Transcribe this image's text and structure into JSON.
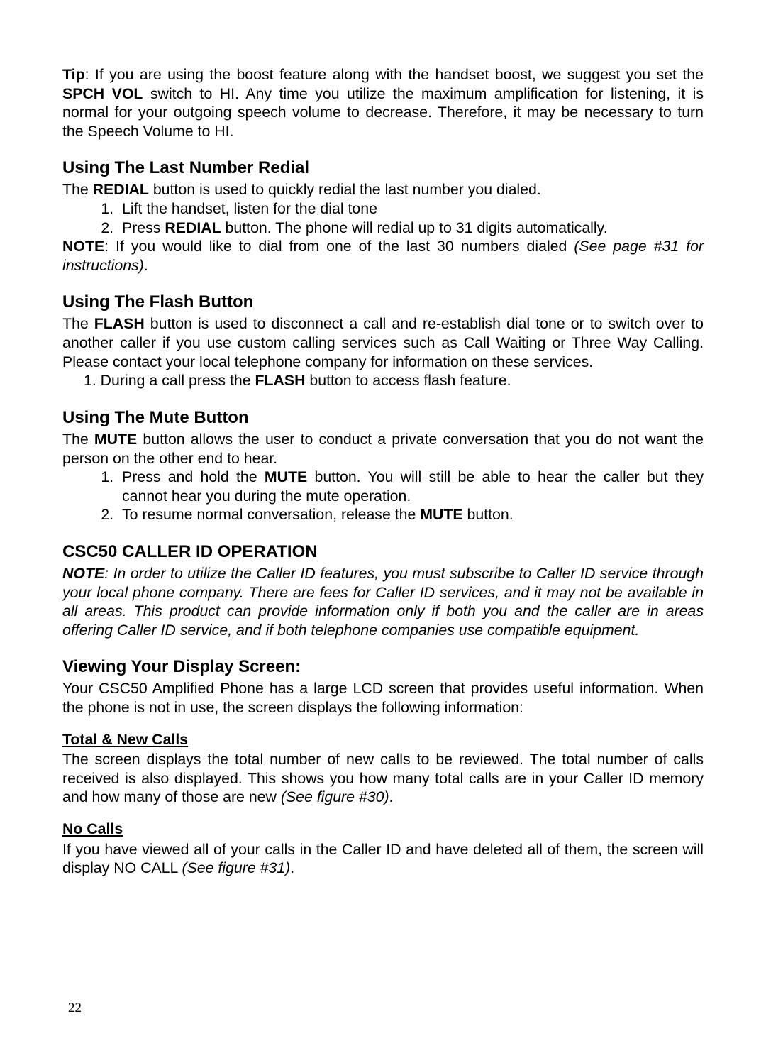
{
  "tip": {
    "label": "Tip",
    "pre": ": If you are using the boost feature along with the handset boost, we suggest you set the ",
    "spch": "SPCH VOL",
    "post": " switch to HI. Any time you utilize the maximum amplification for listening, it is normal for your outgoing speech volume to decrease. Therefore, it may be necessary to turn the Speech Volume to HI."
  },
  "redial": {
    "heading": "Using The Last Number Redial",
    "p_pre": "The ",
    "p_bold": "REDIAL",
    "p_post": " button is used to quickly redial the last number you dialed.",
    "li1": "Lift the handset, listen for the dial tone",
    "li2_pre": "Press ",
    "li2_bold": "REDIAL",
    "li2_post": " button. The phone will redial up to 31 digits automatically.",
    "note_label": "NOTE",
    "note_text": ": If you would like to dial from one of the last 30 numbers dialed ",
    "note_italic": "(See page #31 for instructions)",
    "note_end": "."
  },
  "flash": {
    "heading": "Using The Flash Button",
    "p_pre": "The ",
    "p_bold": "FLASH",
    "p_post": " button is used to disconnect a call and re-establish dial tone or to switch over to another caller if you use custom calling services such as Call Waiting or Three Way Calling. Please contact your local telephone company for information on these services.",
    "li1_pre": "1. During a call press the ",
    "li1_bold": "FLASH",
    "li1_post": " button to access flash feature."
  },
  "mute": {
    "heading": "Using The Mute Button",
    "p_pre": "The ",
    "p_bold": "MUTE",
    "p_post": " button allows the user to conduct a private conversation that you do not want the person on the other end to hear.",
    "li1_pre": "Press and hold the ",
    "li1_bold": "MUTE",
    "li1_post": " button. You will still be able to hear the caller but they cannot hear you during the mute operation.",
    "li2_pre": "To resume normal conversation, release the ",
    "li2_bold": "MUTE",
    "li2_post": " button."
  },
  "cid": {
    "heading": "CSC50 CALLER ID OPERATION",
    "note_label": "NOTE",
    "note_text": ": In order to utilize the Caller ID features, you must subscribe to Caller ID service through your local phone company. There are fees for Caller ID services, and it may not be available in all areas. This product can provide information only if both you and the caller are in areas offering Caller ID service, and if both telephone companies use compatible equipment."
  },
  "view": {
    "heading": "Viewing Your Display Screen:",
    "p": "Your CSC50 Amplified Phone has a large LCD screen that provides useful information. When the phone is not in use, the screen displays the following information:"
  },
  "totalnew": {
    "heading": "Total & New Calls",
    "p_text": "The screen displays the total number of new calls to be reviewed. The total number of calls received is also displayed. This shows you how many total calls are in your Caller ID memory and how many of those are new ",
    "p_italic": "(See figure #30)",
    "p_end": "."
  },
  "nocalls": {
    "heading": "No Calls",
    "p_text": "If you have viewed all of your calls in the Caller ID and have deleted all of them, the screen will display NO CALL ",
    "p_italic": "(See figure #31)",
    "p_end": "."
  },
  "page": "22"
}
